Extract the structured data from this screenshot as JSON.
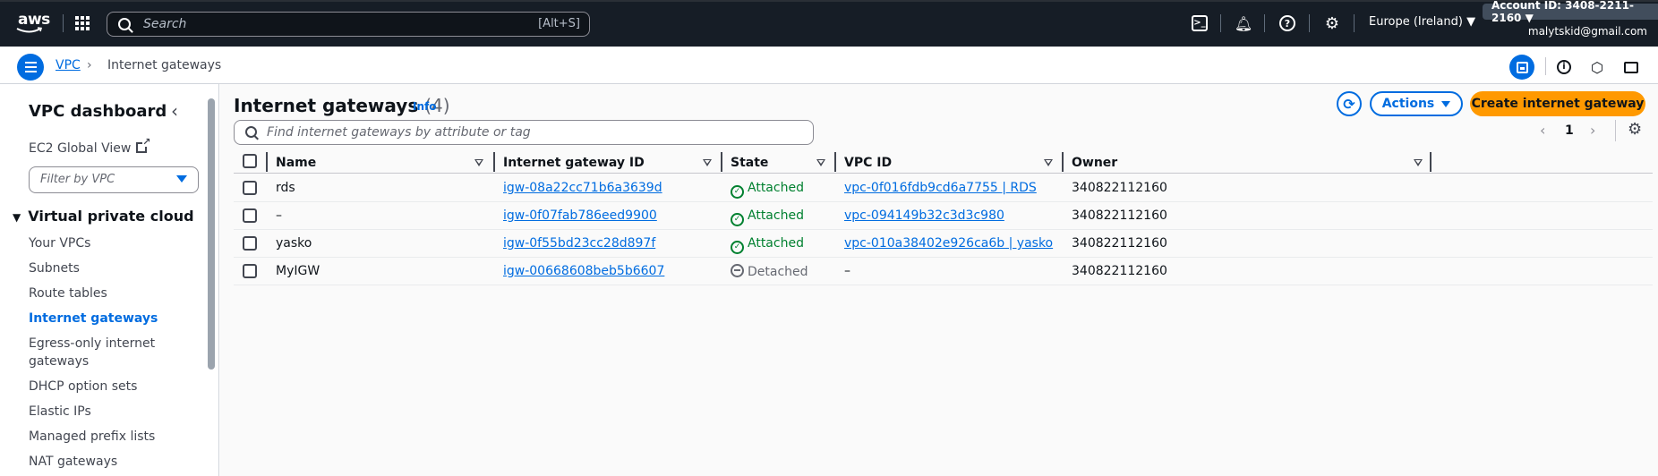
{
  "topnav": {
    "logo": "aws",
    "search_placeholder": "Search",
    "search_shortcut": "[Alt+S]",
    "region": "Europe (Ireland) ▼",
    "account": "Account ID: 3408-2211-2160 ▼",
    "email": "malytskid@gmail.com",
    "icons": [
      "grid-icon",
      "cloudshell-icon",
      "bell-icon",
      "help-icon",
      "gear-icon"
    ]
  },
  "breadcrumb": {
    "root": "VPC",
    "separator": "›",
    "current": "Internet gateways"
  },
  "sidebar": {
    "title": "VPC dashboard",
    "global_view": "EC2 Global View",
    "filter_placeholder": "Filter by VPC",
    "section": "Virtual private cloud",
    "items": [
      {
        "label": "Your VPCs",
        "active": false
      },
      {
        "label": "Subnets",
        "active": false
      },
      {
        "label": "Route tables",
        "active": false
      },
      {
        "label": "Internet gateways",
        "active": true
      },
      {
        "label": "Egress-only internet gateways",
        "active": false
      },
      {
        "label": "DHCP option sets",
        "active": false
      },
      {
        "label": "Elastic IPs",
        "active": false
      },
      {
        "label": "Managed prefix lists",
        "active": false
      },
      {
        "label": "NAT gateways",
        "active": false
      }
    ]
  },
  "main": {
    "title": "Internet gateways",
    "count": "(4)",
    "info": "Info",
    "actions_label": "Actions",
    "create_label": "Create internet gateway",
    "search_placeholder": "Find internet gateways by attribute or tag",
    "page": "1",
    "columns": [
      "Name",
      "Internet gateway ID",
      "State",
      "VPC ID",
      "Owner"
    ],
    "rows": [
      {
        "name": "rds",
        "igw": "igw-08a22cc71b6a3639d",
        "state": "Attached",
        "vpc": "vpc-0f016fdb9cd6a7755 | RDS",
        "owner": "340822112160"
      },
      {
        "name": "–",
        "igw": "igw-0f07fab786eed9900",
        "state": "Attached",
        "vpc": "vpc-094149b32c3d3c980",
        "owner": "340822112160"
      },
      {
        "name": "yasko",
        "igw": "igw-0f55bd23cc28d897f",
        "state": "Attached",
        "vpc": "vpc-010a38402e926ca6b | yasko",
        "owner": "340822112160"
      },
      {
        "name": "MyIGW",
        "igw": "igw-00668608beb5b6607",
        "state": "Detached",
        "vpc": "–",
        "owner": "340822112160"
      }
    ]
  },
  "colors": {
    "nav_bg": "#161d26",
    "link": "#006ce0",
    "primary_button": "#ff9900",
    "attached": "#00802f",
    "detached": "#656871"
  }
}
